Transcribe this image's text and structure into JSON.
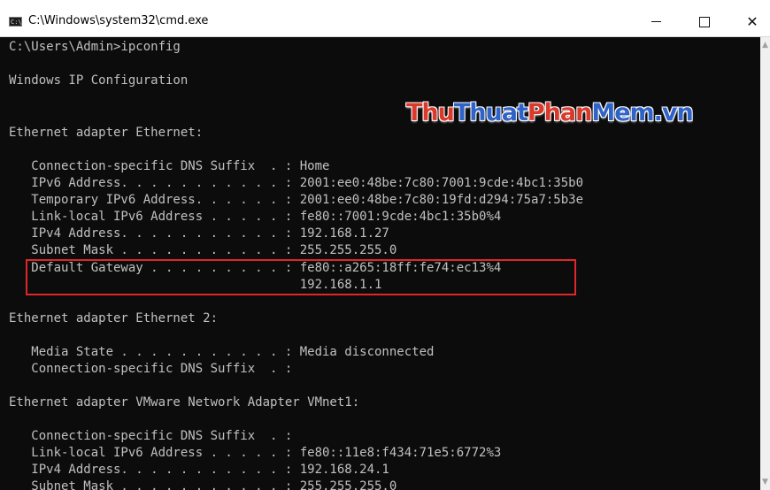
{
  "window": {
    "title": "C:\\Windows\\system32\\cmd.exe",
    "app_icon_text": "C:\\",
    "minimize_glyph": "—",
    "maximize_glyph": "☐",
    "close_glyph": "✕"
  },
  "scrollbar": {
    "up_glyph": "▲",
    "down_glyph": "▼"
  },
  "watermark": {
    "part1": "Thu",
    "part2": "Thuat",
    "part3": "Phan",
    "part4": "Mem",
    "part5": ".vn"
  },
  "console": {
    "lines": [
      "C:\\Users\\Admin>ipconfig",
      "",
      "Windows IP Configuration",
      "",
      "",
      "Ethernet adapter Ethernet:",
      "",
      "   Connection-specific DNS Suffix  . : Home",
      "   IPv6 Address. . . . . . . . . . . : 2001:ee0:48be:7c80:7001:9cde:4bc1:35b0",
      "   Temporary IPv6 Address. . . . . . : 2001:ee0:48be:7c80:19fd:d294:75a7:5b3e",
      "   Link-local IPv6 Address . . . . . : fe80::7001:9cde:4bc1:35b0%4",
      "   IPv4 Address. . . . . . . . . . . : 192.168.1.27",
      "   Subnet Mask . . . . . . . . . . . : 255.255.255.0",
      "   Default Gateway . . . . . . . . . : fe80::a265:18ff:fe74:ec13%4",
      "                                       192.168.1.1",
      "",
      "Ethernet adapter Ethernet 2:",
      "",
      "   Media State . . . . . . . . . . . : Media disconnected",
      "   Connection-specific DNS Suffix  . :",
      "",
      "Ethernet adapter VMware Network Adapter VMnet1:",
      "",
      "   Connection-specific DNS Suffix  . :",
      "   Link-local IPv6 Address . . . . . : fe80::11e8:f434:71e5:6772%3",
      "   IPv4 Address. . . . . . . . . . . : 192.168.24.1",
      "   Subnet Mask . . . . . . . . . . . : 255.255.255.0"
    ]
  },
  "colors": {
    "console_bg": "#0c0c0c",
    "console_text": "#c0c0c0",
    "highlight_border": "#e0262a"
  }
}
